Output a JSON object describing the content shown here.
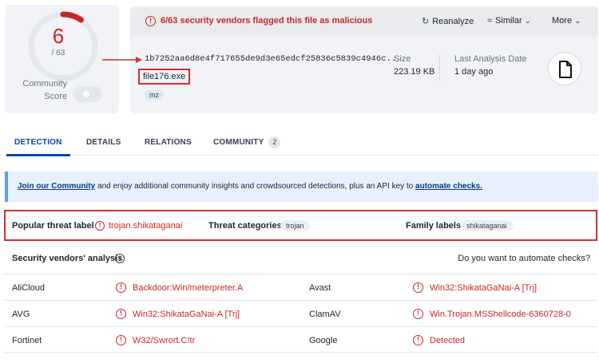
{
  "score": {
    "detected": "6",
    "total": "/ 63",
    "ratio": 0.095,
    "community_label": "Community Score",
    "ring_color": "#c62828"
  },
  "header": {
    "alert_text": "6/63 security vendors flagged this file as malicious",
    "alert_icon": "alert-circle-icon",
    "actions": [
      {
        "label": "Reanalyze",
        "icon": "refresh-icon"
      },
      {
        "label": "Similar",
        "icon": "similar-icon"
      },
      {
        "label": "More",
        "icon": "chevron-down-icon"
      }
    ]
  },
  "file": {
    "hash": "1b7252aa6d8e4f717655de9d3e65edcf25836c5839c4946c...",
    "name": "file176.exe",
    "tag": "mz",
    "size_label": "Size",
    "size_value": "223.19 KB",
    "analysis_label": "Last Analysis Date",
    "analysis_value": "1 day ago",
    "type_icon": "file-icon"
  },
  "tabs": [
    {
      "label": "DETECTION",
      "active": true
    },
    {
      "label": "DETAILS",
      "active": false
    },
    {
      "label": "RELATIONS",
      "active": false
    },
    {
      "label": "COMMUNITY",
      "active": false,
      "count": "2"
    }
  ],
  "banner": {
    "link1": "Join our Community",
    "middle": " and enjoy additional community insights and crowdsourced detections, plus an API key to ",
    "link2": "automate checks."
  },
  "threat": {
    "popular_label": "Popular threat label",
    "popular_value": "trojan.shikataganai",
    "categories_label": "Threat categories",
    "categories_value": "trojan",
    "family_label": "Family labels",
    "family_value": "shikataganai"
  },
  "vendors": {
    "title": "Security vendors' analysis",
    "automate_question": "Do you want to automate checks?",
    "rows": [
      {
        "left_vendor": "AliCloud",
        "left_result": "Backdoor:Win/meterpreter.A",
        "right_vendor": "Avast",
        "right_result": "Win32:ShikataGaNai-A [Trj]"
      },
      {
        "left_vendor": "AVG",
        "left_result": "Win32:ShikataGaNai-A [Trj]",
        "right_vendor": "ClamAV",
        "right_result": "Win.Trojan.MSShellcode-6360728-0"
      },
      {
        "left_vendor": "Fortinet",
        "left_result": "W32/Swrort.C!tr",
        "right_vendor": "Google",
        "right_result": "Detected"
      }
    ]
  },
  "colors": {
    "malicious": "#c62828",
    "accent": "#0b4aa8",
    "highlight_box": "#d32f2f"
  }
}
